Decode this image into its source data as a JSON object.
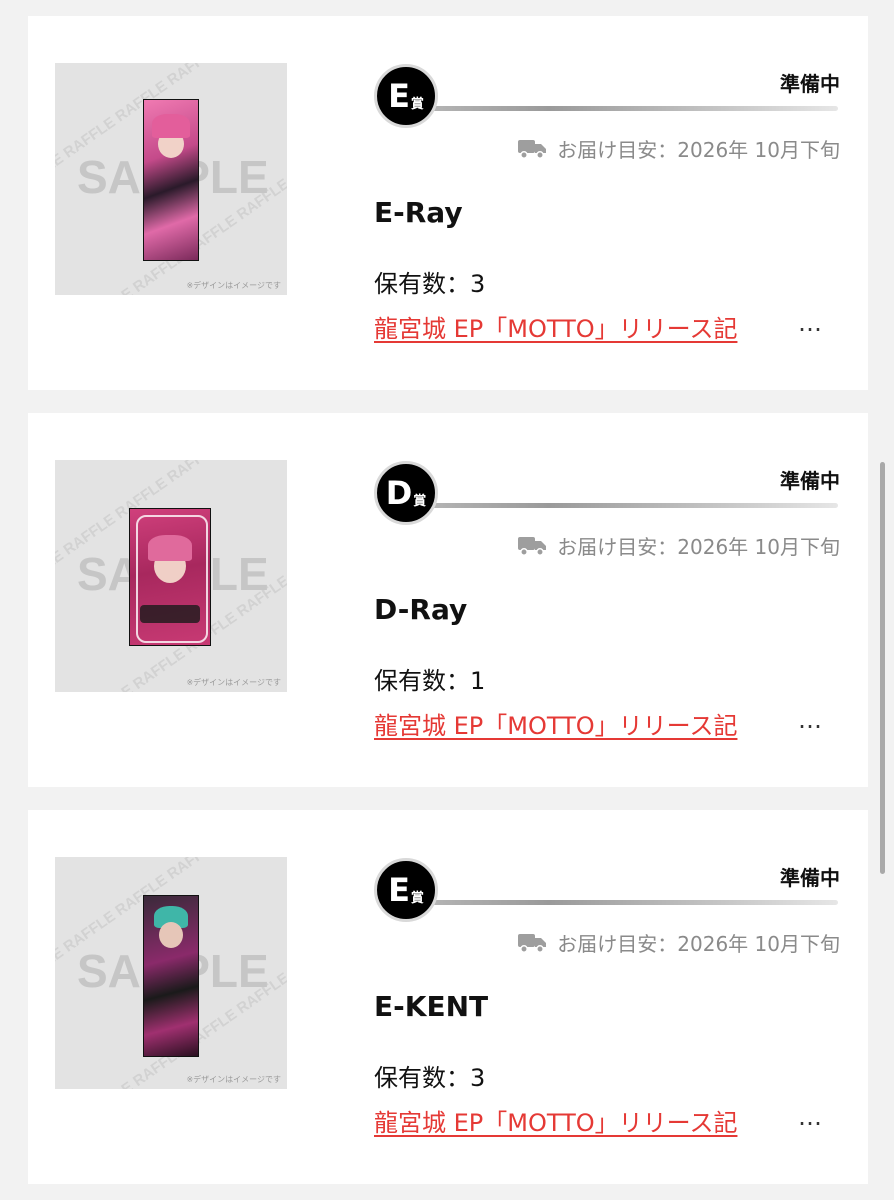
{
  "items": [
    {
      "badge_letter": "E",
      "badge_sub": "賞",
      "status": "準備中",
      "delivery": "お届け目安：2026年 10月下旬",
      "name": "E-Ray",
      "quantity": "保有数：3",
      "link": "龍宮城 EP「MOTTO」リリース記",
      "ellipsis": "…",
      "thumb_watermark": "SAMPLE",
      "thumb_note": "※デザインはイメージです",
      "truck_icon": "truck-icon"
    },
    {
      "badge_letter": "D",
      "badge_sub": "賞",
      "status": "準備中",
      "delivery": "お届け目安：2026年 10月下旬",
      "name": "D-Ray",
      "quantity": "保有数：1",
      "link": "龍宮城 EP「MOTTO」リリース記",
      "ellipsis": "…",
      "thumb_watermark": "SAMPLE",
      "thumb_note": "※デザインはイメージです",
      "truck_icon": "truck-icon"
    },
    {
      "badge_letter": "E",
      "badge_sub": "賞",
      "status": "準備中",
      "delivery": "お届け目安：2026年 10月下旬",
      "name": "E-KENT",
      "quantity": "保有数：3",
      "link": "龍宮城 EP「MOTTO」リリース記",
      "ellipsis": "…",
      "thumb_watermark": "SAMPLE",
      "thumb_note": "※デザインはイメージです",
      "truck_icon": "truck-icon"
    }
  ],
  "colors": {
    "link": "#e53935",
    "badge": "#000000",
    "muted": "#8a8a8a"
  }
}
